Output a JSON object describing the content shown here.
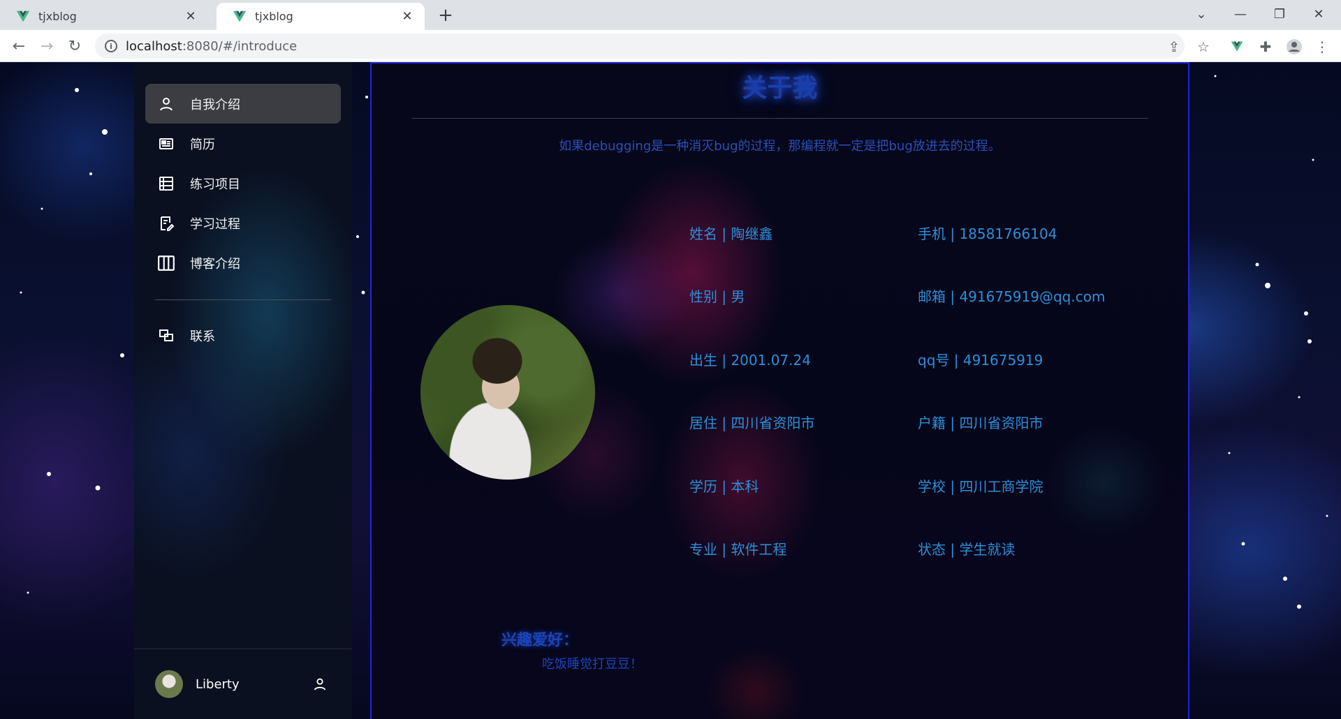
{
  "browser": {
    "tabs": [
      {
        "title": "tjxblog",
        "active": false
      },
      {
        "title": "tjxblog",
        "active": true
      }
    ],
    "url_host": "localhost",
    "url_path": ":8080/#/introduce"
  },
  "sidebar": {
    "items": [
      {
        "label": "自我介绍",
        "icon": "user-icon",
        "active": true
      },
      {
        "label": "简历",
        "icon": "resume-icon",
        "active": false
      },
      {
        "label": "练习项目",
        "icon": "list-icon",
        "active": false
      },
      {
        "label": "学习过程",
        "icon": "edit-note-icon",
        "active": false
      },
      {
        "label": "博客介绍",
        "icon": "columns-icon",
        "active": false
      }
    ],
    "contact_label": "联系",
    "user_name": "Liberty"
  },
  "main": {
    "title": "关于我",
    "motto": "如果debugging是一种消灭bug的过程，那编程就一定是把bug放进去的过程。",
    "info_left": [
      "姓名 | 陶继鑫",
      "性别 | 男",
      "出生 | 2001.07.24",
      "居住 | 四川省资阳市",
      "学历 | 本科",
      "专业 | 软件工程"
    ],
    "info_right": [
      "手机 | 18581766104",
      "邮箱 | 491675919@qq.com",
      "qq号 | 491675919",
      "户籍 | 四川省资阳市",
      "学校 | 四川工商学院",
      "状态 | 学生就读"
    ],
    "hobby_title": "兴趣爱好：",
    "hobby_text": "吃饭睡觉打豆豆！"
  },
  "colors": {
    "panel_border": "#2424d8",
    "info_text": "#2d8fd8",
    "title_glow": "#1b3fa8"
  }
}
